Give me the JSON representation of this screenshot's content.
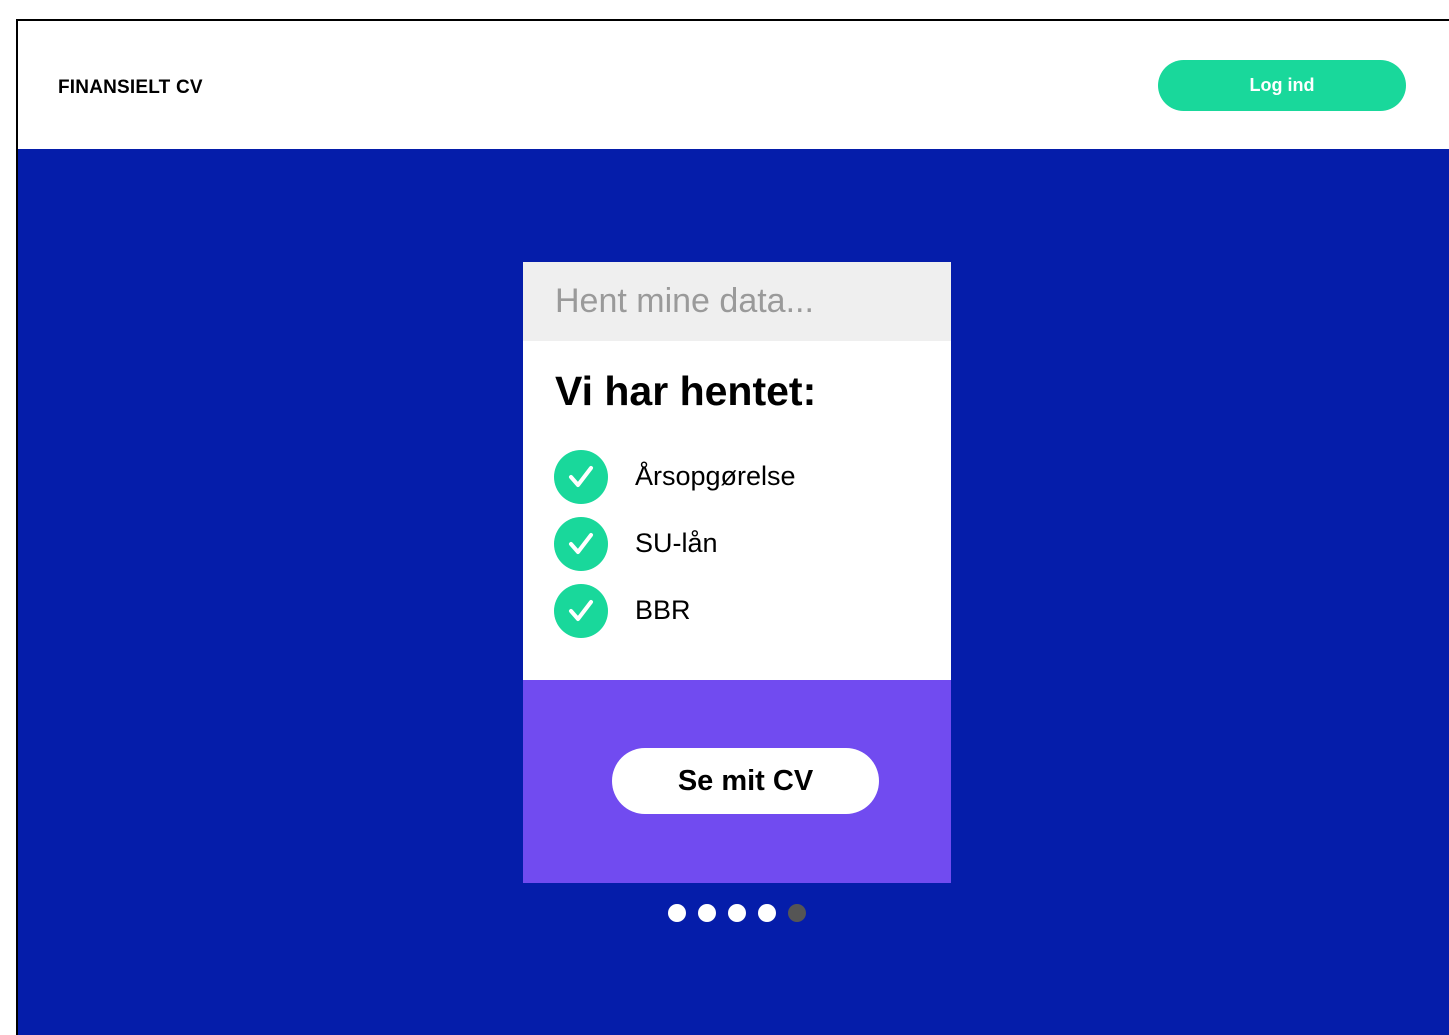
{
  "header": {
    "brand": "FINANSIELT CV",
    "login_label": "Log ind"
  },
  "card": {
    "top_text": "Hent mine data...",
    "title": "Vi har hentet:",
    "items": [
      {
        "label": "Årsopgørelse",
        "icon": "check-icon"
      },
      {
        "label": "SU-lån",
        "icon": "check-icon"
      },
      {
        "label": "BBR",
        "icon": "check-icon"
      }
    ],
    "cta_label": "Se mit CV"
  },
  "carousel": {
    "total": 5,
    "active_index": 4
  },
  "colors": {
    "accent": "#19d89b",
    "hero_background": "#051daa",
    "card_bottom": "#714bf0",
    "card_top": "#efefef",
    "active_dot": "#555555"
  }
}
